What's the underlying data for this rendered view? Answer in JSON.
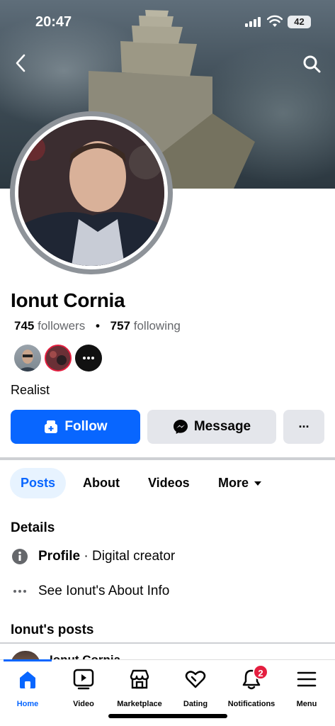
{
  "status_bar": {
    "time": "20:47",
    "battery": "42"
  },
  "profile": {
    "name": "Ionut Cornia",
    "followers_count": "745",
    "followers_label": "followers",
    "following_count": "757",
    "following_label": "following",
    "bio": "Realist"
  },
  "actions": {
    "follow": "Follow",
    "message": "Message",
    "more": "···"
  },
  "tabs": [
    "Posts",
    "About",
    "Videos",
    "More"
  ],
  "details": {
    "heading": "Details",
    "profile_label": "Profile",
    "profile_value": " · Digital creator",
    "about_link": "See Ionut's About Info"
  },
  "posts_heading": "Ionut's posts",
  "bottom_nav": [
    {
      "label": "Home",
      "icon": "home-icon"
    },
    {
      "label": "Video",
      "icon": "video-icon"
    },
    {
      "label": "Marketplace",
      "icon": "marketplace-icon"
    },
    {
      "label": "Dating",
      "icon": "dating-icon"
    },
    {
      "label": "Notifications",
      "icon": "bell-icon",
      "badge": "2"
    },
    {
      "label": "Menu",
      "icon": "menu-icon"
    }
  ],
  "colors": {
    "accent": "#0866ff",
    "badge": "#e41e3f",
    "button_gray": "#e4e6eb"
  }
}
